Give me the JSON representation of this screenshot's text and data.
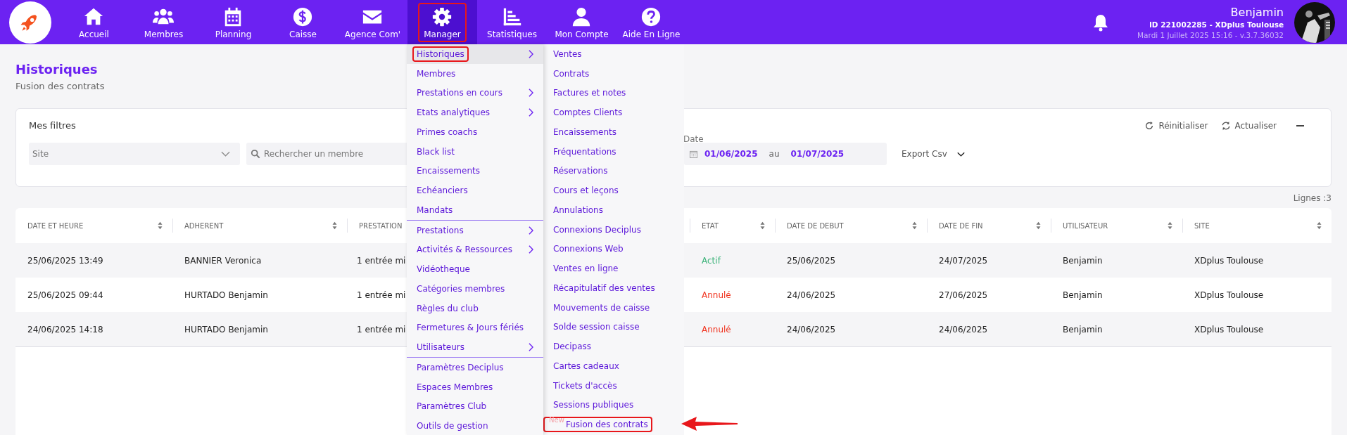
{
  "nav": {
    "items": [
      {
        "label": "Accueil",
        "selected": false,
        "highlighted": false
      },
      {
        "label": "Membres",
        "selected": false,
        "highlighted": false
      },
      {
        "label": "Planning",
        "selected": false,
        "highlighted": false
      },
      {
        "label": "Caisse",
        "selected": false,
        "highlighted": false
      },
      {
        "label": "Agence Com'",
        "selected": false,
        "highlighted": false
      },
      {
        "label": "Manager",
        "selected": true,
        "highlighted": true
      },
      {
        "label": "Statistiques",
        "selected": false,
        "highlighted": false
      },
      {
        "label": "Mon Compte",
        "selected": false,
        "highlighted": false
      },
      {
        "label": "Aide En Ligne",
        "selected": false,
        "highlighted": false
      }
    ]
  },
  "user": {
    "name": "Benjamin",
    "id_line": "ID 221002285 - XDplus Toulouse",
    "date_line": "Mardi 1 Juillet 2025 15:16 - v.3.7.36032"
  },
  "page": {
    "title": "Historiques",
    "subtitle": "Fusion des contrats"
  },
  "filters": {
    "title": "Mes filtres",
    "actions": [
      "Réinitialiser",
      "Actualiser"
    ],
    "site_select": {
      "placeholder": "Site"
    },
    "search": {
      "placeholder": "Rechercher un membre"
    },
    "date": {
      "label": "Date",
      "from": "01/06/2025",
      "separator": "au",
      "to": "01/07/2025"
    },
    "export": {
      "label": "Export Csv"
    }
  },
  "row_count": "Lignes :3",
  "table": {
    "columns": [
      "DATE ET HEURE",
      "ADHERENT",
      "PRESTATION",
      "ETAT",
      "DATE DE DEBUT",
      "DATE DE FIN",
      "UTILISATEUR",
      "SITE"
    ],
    "rows": [
      {
        "date": "25/06/2025 13:49",
        "member": "BANNIER Veronica",
        "service": "1 entrée mi",
        "status": {
          "text": "Actif",
          "color": "#3cb37a"
        },
        "start": "25/06/2025",
        "end": "24/07/2025",
        "user": "Benjamin",
        "site": "XDplus Toulouse"
      },
      {
        "date": "25/06/2025 09:44",
        "member": "HURTADO Benjamin",
        "service": "1 entrée mi",
        "status": {
          "text": "Annulé",
          "color": "#f0321e"
        },
        "start": "24/06/2025",
        "end": "27/06/2025",
        "user": "Benjamin",
        "site": "XDplus Toulouse"
      },
      {
        "date": "24/06/2025 14:18",
        "member": "HURTADO Benjamin",
        "service": "1 entrée mi",
        "status": {
          "text": "Annulé",
          "color": "#f0321e"
        },
        "start": "24/06/2025",
        "end": "24/06/2025",
        "user": "Benjamin",
        "site": "XDplus Toulouse"
      }
    ]
  },
  "menu": {
    "pointer_arrow": true,
    "columns": [
      {
        "groups": [
          [
            {
              "label": "Historiques",
              "submenu": true,
              "selected": true,
              "highlighted": true
            },
            {
              "label": "Membres",
              "submenu": false,
              "selected": false,
              "highlighted": false
            },
            {
              "label": "Prestations en cours",
              "submenu": true,
              "selected": false,
              "highlighted": false
            },
            {
              "label": "Etats analytiques",
              "submenu": true,
              "selected": false,
              "highlighted": false
            },
            {
              "label": "Primes coachs",
              "submenu": false,
              "selected": false,
              "highlighted": false
            },
            {
              "label": "Black list",
              "submenu": false,
              "selected": false,
              "highlighted": false
            },
            {
              "label": "Encaissements",
              "submenu": false,
              "selected": false,
              "highlighted": false
            },
            {
              "label": "Echéanciers",
              "submenu": false,
              "selected": false,
              "highlighted": false
            },
            {
              "label": "Mandats",
              "submenu": false,
              "selected": false,
              "highlighted": false
            }
          ],
          [
            {
              "label": "Prestations",
              "submenu": true,
              "selected": false,
              "highlighted": false
            },
            {
              "label": "Activités & Ressources",
              "submenu": true,
              "selected": false,
              "highlighted": false
            },
            {
              "label": "Vidéotheque",
              "submenu": false,
              "selected": false,
              "highlighted": false
            },
            {
              "label": "Catégories membres",
              "submenu": false,
              "selected": false,
              "highlighted": false
            },
            {
              "label": "Règles du club",
              "submenu": false,
              "selected": false,
              "highlighted": false
            },
            {
              "label": "Fermetures & Jours fériés",
              "submenu": false,
              "selected": false,
              "highlighted": false
            },
            {
              "label": "Utilisateurs",
              "submenu": true,
              "selected": false,
              "highlighted": false
            }
          ],
          [
            {
              "label": "Paramètres Deciplus",
              "submenu": false,
              "selected": false,
              "highlighted": false
            },
            {
              "label": "Espaces Membres",
              "submenu": false,
              "selected": false,
              "highlighted": false
            },
            {
              "label": "Paramètres Club",
              "submenu": false,
              "selected": false,
              "highlighted": false
            },
            {
              "label": "Outils de gestion",
              "submenu": false,
              "selected": false,
              "highlighted": false
            }
          ]
        ]
      },
      {
        "groups": [
          [
            {
              "label": "Ventes",
              "submenu": false,
              "selected": false,
              "highlighted": false
            },
            {
              "label": "Contrats",
              "submenu": false,
              "selected": false,
              "highlighted": false
            },
            {
              "label": "Factures et notes",
              "submenu": false,
              "selected": false,
              "highlighted": false
            },
            {
              "label": "Comptes Clients",
              "submenu": false,
              "selected": false,
              "highlighted": false
            },
            {
              "label": "Encaissements",
              "submenu": false,
              "selected": false,
              "highlighted": false
            },
            {
              "label": "Fréquentations",
              "submenu": false,
              "selected": false,
              "highlighted": false
            },
            {
              "label": "Réservations",
              "submenu": false,
              "selected": false,
              "highlighted": false
            },
            {
              "label": "Cours et leçons",
              "submenu": false,
              "selected": false,
              "highlighted": false
            },
            {
              "label": "Annulations",
              "submenu": false,
              "selected": false,
              "highlighted": false
            },
            {
              "label": "Connexions Deciplus",
              "submenu": false,
              "selected": false,
              "highlighted": false
            },
            {
              "label": "Connexions Web",
              "submenu": false,
              "selected": false,
              "highlighted": false
            },
            {
              "label": "Ventes en ligne",
              "submenu": false,
              "selected": false,
              "highlighted": false
            },
            {
              "label": "Récapitulatif des ventes",
              "submenu": false,
              "selected": false,
              "highlighted": false
            },
            {
              "label": "Mouvements de caisse",
              "submenu": false,
              "selected": false,
              "highlighted": false
            },
            {
              "label": "Solde session caisse",
              "submenu": false,
              "selected": false,
              "highlighted": false
            },
            {
              "label": "Decipass",
              "submenu": false,
              "selected": false,
              "highlighted": false
            },
            {
              "label": "Cartes cadeaux",
              "submenu": false,
              "selected": false,
              "highlighted": false
            },
            {
              "label": "Tickets d'accès",
              "submenu": false,
              "selected": false,
              "highlighted": false
            },
            {
              "label": "Sessions publiques",
              "submenu": false,
              "selected": false,
              "highlighted": false
            },
            {
              "label": "Fusion des contrats",
              "submenu": false,
              "selected": false,
              "highlighted": true,
              "badge": "New"
            }
          ]
        ]
      }
    ]
  }
}
